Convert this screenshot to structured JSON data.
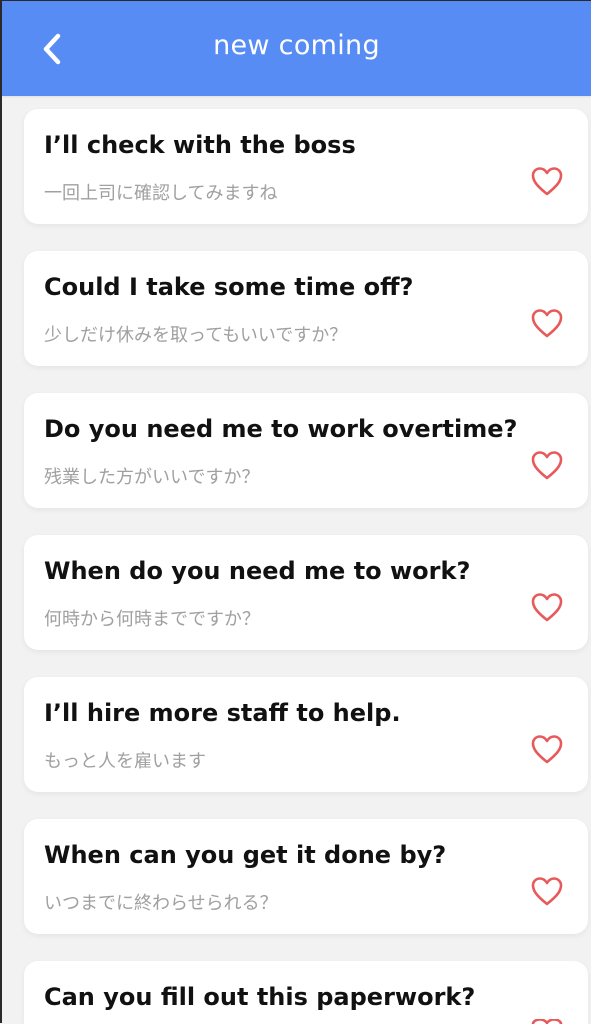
{
  "header": {
    "title": "new coming",
    "back_icon": "chevron-left-icon",
    "background_color": "#578cf5"
  },
  "phrases": [
    {
      "en": "I’ll check with the boss",
      "ja": "一回上司に確認してみますね",
      "favorite_icon": "heart-outline-icon"
    },
    {
      "en": "Could I take some time off?",
      "ja": "少しだけ休みを取ってもいいですか？",
      "favorite_icon": "heart-outline-icon"
    },
    {
      "en": "Do you need me to work overtime?",
      "ja": "残業した方がいいですか？",
      "favorite_icon": "heart-outline-icon"
    },
    {
      "en": "When do you need me to work?",
      "ja": "何時から何時までですか？",
      "favorite_icon": "heart-outline-icon"
    },
    {
      "en": "I’ll hire more staff to help.",
      "ja": "もっと人を雇います",
      "favorite_icon": "heart-outline-icon"
    },
    {
      "en": "When can you get it done by?",
      "ja": "いつまでに終わらせられる？",
      "favorite_icon": "heart-outline-icon"
    },
    {
      "en": "Can you fill out this paperwork?",
      "ja": "",
      "favorite_icon": "heart-outline-icon"
    }
  ],
  "colors": {
    "heart": "#e85a5a",
    "subtitle": "#a0a0a0",
    "card": "#ffffff",
    "page_background": "#f2f2f2"
  }
}
